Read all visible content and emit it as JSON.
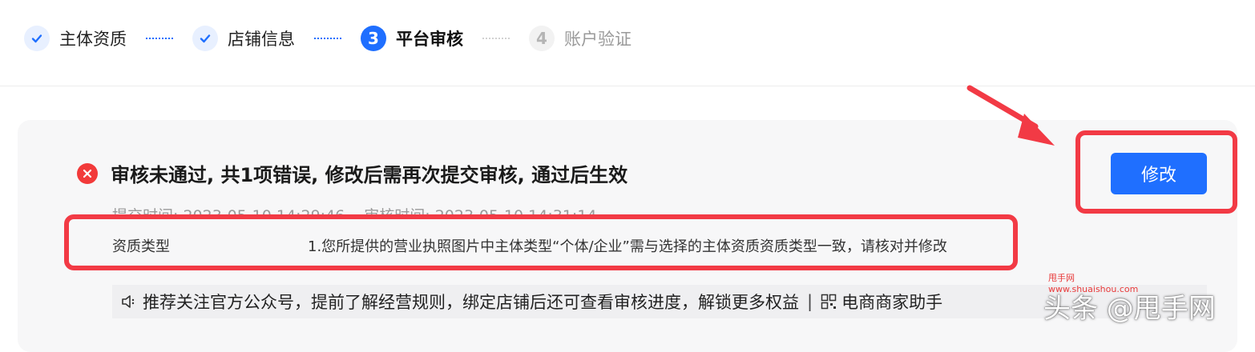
{
  "steps": [
    {
      "label": "主体资质",
      "status": "done"
    },
    {
      "label": "店铺信息",
      "status": "done"
    },
    {
      "label": "平台审核",
      "status": "active",
      "number": "3"
    },
    {
      "label": "账户验证",
      "status": "pending",
      "number": "4"
    }
  ],
  "review": {
    "title": "审核未通过, 共1项错误, 修改后需再次提交审核, 通过后生效",
    "submit_time": "提交时间: 2023-05-10 14:29:46",
    "review_time": "审核时间: 2023-05-10 14:31:14",
    "errors": [
      {
        "field": "资质类型",
        "reason": "1.您所提供的营业执照图片中主体类型“个体/企业”需与选择的主体资质资质类型一致，请核对并修改"
      }
    ],
    "edit_label": "修改"
  },
  "notice": {
    "text": "推荐关注官方公众号，提前了解经营规则，绑定店铺后还可查看审核进度，解锁更多权益",
    "separator": "|",
    "assistant": "电商商家助手"
  },
  "watermark": {
    "small_name": "甩手网",
    "small_url": "www.shuaishou.com",
    "main": "头条 @甩手网"
  },
  "colors": {
    "primary": "#1f6fff",
    "error": "#f23a3a",
    "highlight": "#f23a45",
    "card_bg": "#f7f7f8"
  },
  "icons": {
    "done": "check-icon",
    "error": "close-circle-icon",
    "notice": "speaker-icon",
    "assistant": "qr-code-icon"
  }
}
